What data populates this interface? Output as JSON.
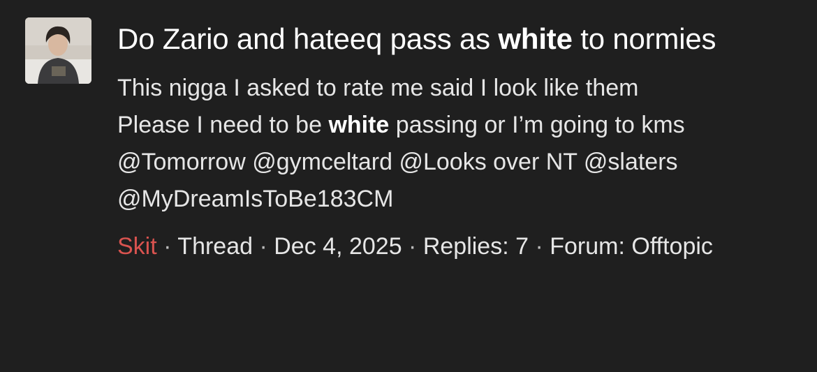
{
  "result": {
    "avatar_icon": "user-avatar-photo",
    "title_parts": {
      "before": "Do Zario and hateeq pass as ",
      "highlight": "white",
      "after": " to normies"
    },
    "snippet": {
      "line1": "This nigga I asked to rate me said I look like them",
      "line2_before": "Please I need to be ",
      "line2_highlight": "white",
      "line2_after": " passing or I’m going to kms",
      "mentions": "@Tomorrow @gymceltard @Looks over NT @slaters @MyDreamIsToBe183CM"
    },
    "meta": {
      "author": "Skit",
      "sep": " · ",
      "type": "Thread",
      "date": "Dec 4, 2025",
      "replies": "Replies: 7",
      "forum": "Forum: Offtopic"
    },
    "colors": {
      "background": "#1f1f1f",
      "author": "#d9534f",
      "text": "#e6e6e6"
    }
  }
}
